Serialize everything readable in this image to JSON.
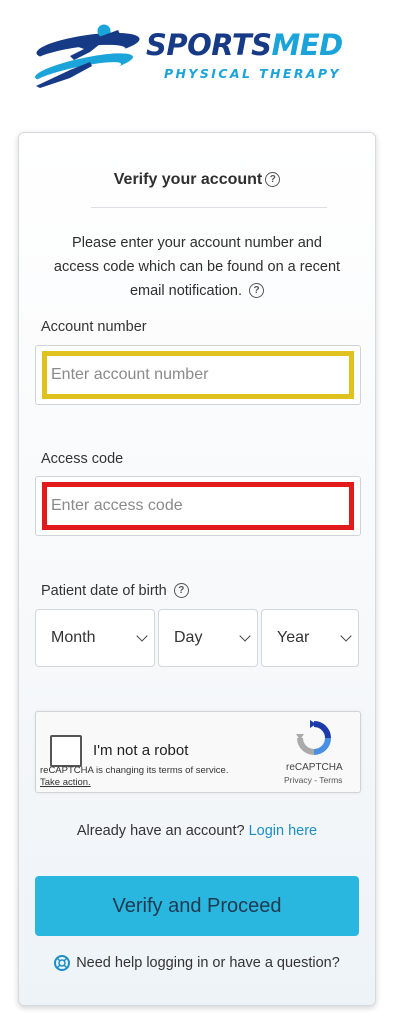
{
  "brand": {
    "name_part1": "SPORTS",
    "name_part2": "MED",
    "tagline": "PHYSICAL THERAPY",
    "colors": {
      "navy": "#163a86",
      "cyan": "#1aa4d9"
    }
  },
  "card": {
    "title": "Verify your account",
    "help_icon": "?",
    "intro": "Please enter your account number and access code which can be found on a recent email notification.",
    "account": {
      "label": "Account number",
      "placeholder": "Enter account number",
      "highlight": "#e0c21f"
    },
    "access": {
      "label": "Access code",
      "placeholder": "Enter access code",
      "highlight": "#e11b1b"
    },
    "dob": {
      "label": "Patient date of birth",
      "month": "Month",
      "day": "Day",
      "year": "Year"
    },
    "recaptcha": {
      "label": "I'm not a robot",
      "notice": "reCAPTCHA is changing its terms of service.",
      "take_action": "Take action.",
      "brand": "reCAPTCHA",
      "links": "Privacy - Terms"
    },
    "already_text": "Already have an account?",
    "login_link": "Login here",
    "verify_button": "Verify and Proceed",
    "help_text": "Need help logging in or have a question?",
    "button_color": "#29b6df"
  }
}
